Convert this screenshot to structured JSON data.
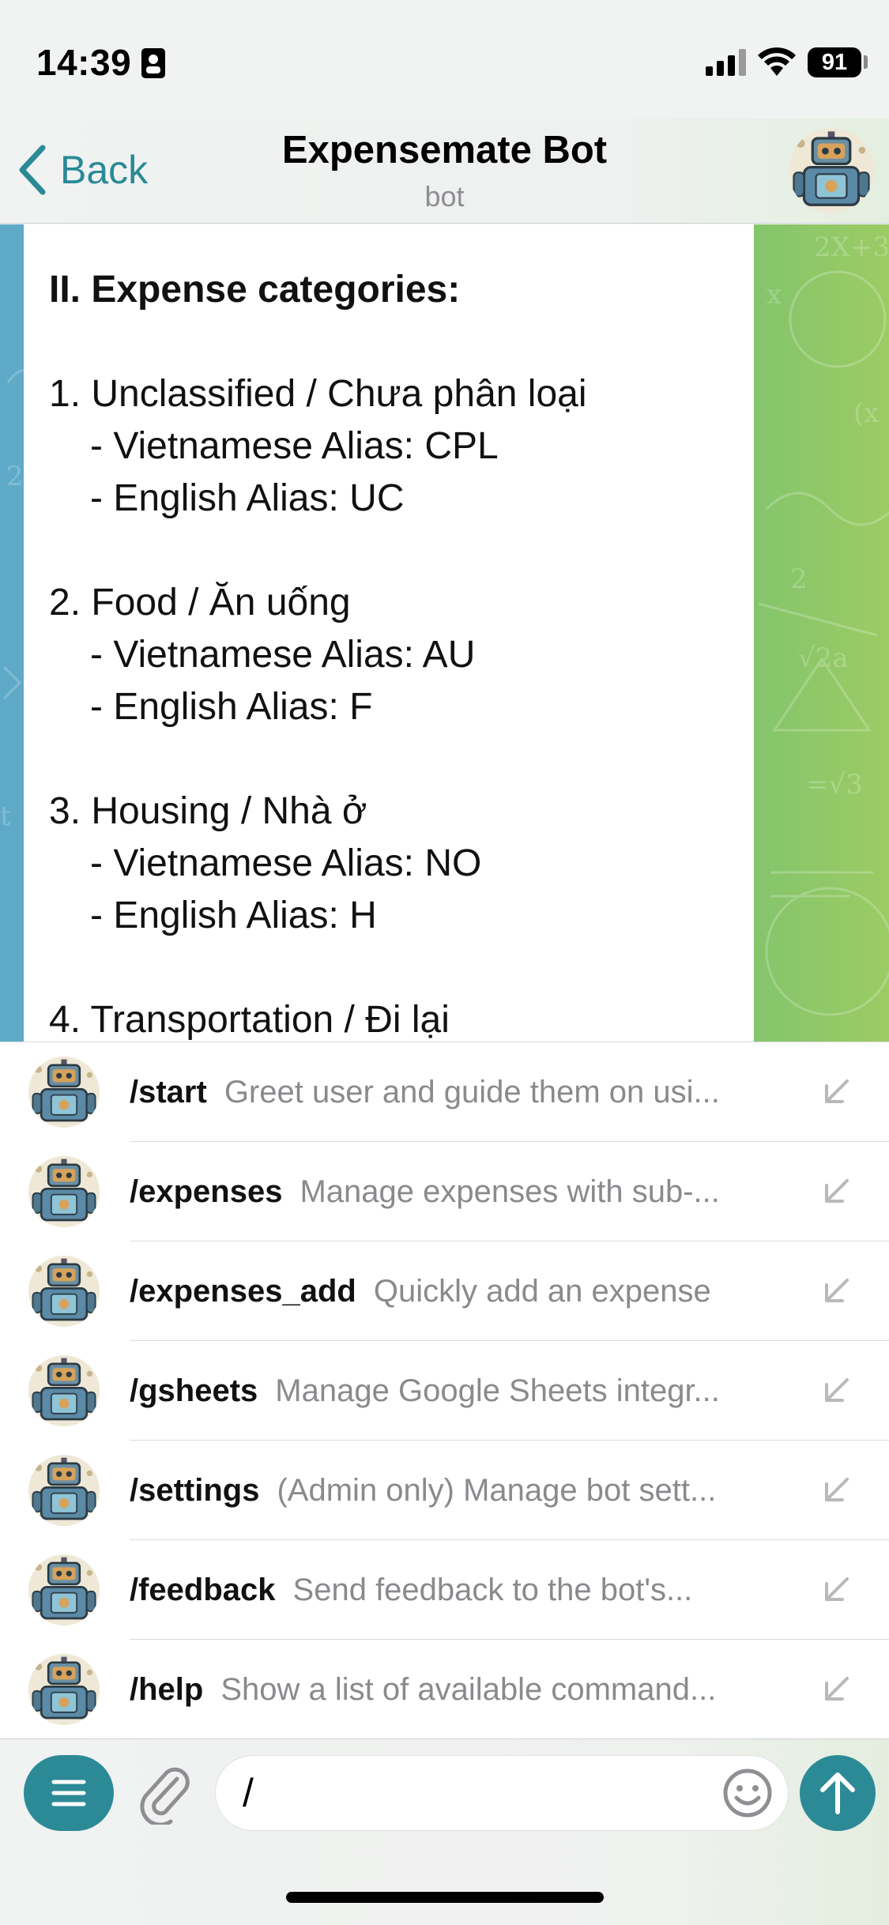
{
  "status_bar": {
    "time": "14:39",
    "battery": "91",
    "icons": [
      "id-card-icon",
      "cellular-signal-icon",
      "wifi-icon",
      "battery-icon"
    ]
  },
  "header": {
    "back_label": "Back",
    "title": "Expensemate Bot",
    "subtitle": "bot",
    "avatar_icon": "robot-avatar-icon"
  },
  "message": {
    "heading": "II. Expense categories:",
    "categories": [
      {
        "title": "1. Unclassified / Chưa phân loại",
        "vietnamese_alias": "- Vietnamese Alias: CPL",
        "english_alias": "- English Alias: UC"
      },
      {
        "title": "2. Food / Ăn uống",
        "vietnamese_alias": "- Vietnamese Alias: AU",
        "english_alias": "- English Alias: F"
      },
      {
        "title": "3. Housing / Nhà ở",
        "vietnamese_alias": "- Vietnamese Alias: NO",
        "english_alias": "- English Alias: H"
      },
      {
        "title": "4. Transportation / Đi lại"
      }
    ]
  },
  "commands": [
    {
      "name": "/start",
      "description": "Greet user and guide them on usi..."
    },
    {
      "name": "/expenses",
      "description": "Manage expenses with sub-..."
    },
    {
      "name": "/expenses_add",
      "description": "Quickly add an expense"
    },
    {
      "name": "/gsheets",
      "description": "Manage Google Sheets integr..."
    },
    {
      "name": "/settings",
      "description": "(Admin only) Manage bot sett..."
    },
    {
      "name": "/feedback",
      "description": "Send feedback to the bot's..."
    },
    {
      "name": "/help",
      "description": "Show a list of available command..."
    }
  ],
  "input": {
    "value": "/",
    "icons": [
      "menu-icon",
      "paperclip-icon",
      "emoji-icon",
      "send-arrow-icon"
    ]
  },
  "colors": {
    "accent": "#2c8a96",
    "back_text": "#2a8a96",
    "secondary_text": "#8a8a8e"
  }
}
